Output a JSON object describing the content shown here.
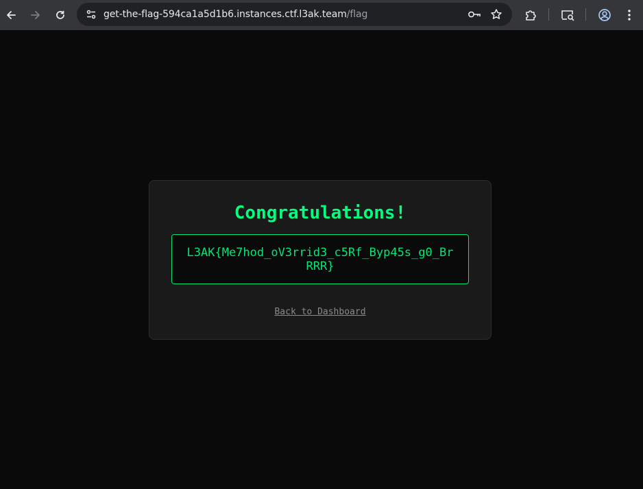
{
  "browser": {
    "url_host": "get-the-flag-594ca1a5d1b6.instances.ctf.l3ak.team",
    "url_path": "/flag",
    "icons": {
      "back": "back-arrow-icon",
      "forward": "forward-arrow-icon",
      "reload": "reload-icon",
      "site_info": "tune-icon",
      "password": "key-icon",
      "bookmark": "star-icon",
      "extensions": "puzzle-icon",
      "cast": "cast-search-icon",
      "profile": "profile-icon",
      "menu": "kebab-menu-icon"
    }
  },
  "page": {
    "title": "Congratulations!",
    "flag": "L3AK{Me7hod_oV3rrid3_c5Rf_Byp45s_g0_BrRRR}",
    "back_link": "Back to Dashboard"
  },
  "colors": {
    "background": "#0a0a0a",
    "card": "#1a1a1a",
    "accent": "#00e676",
    "link": "#8a8a8a"
  }
}
